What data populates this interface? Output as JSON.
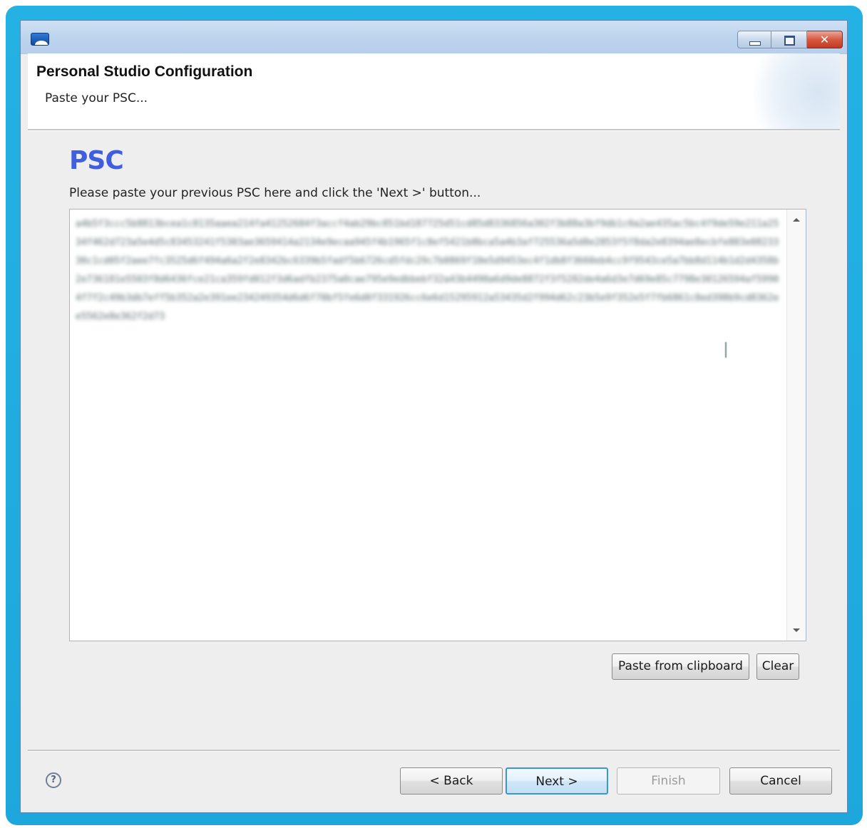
{
  "window": {
    "icon": "app-window-icon",
    "controls": {
      "minimize": "minimize-icon",
      "maximize": "maximize-icon",
      "close_glyph": "✕"
    }
  },
  "header": {
    "title": "Personal Studio Configuration",
    "subtitle": "Paste your PSC..."
  },
  "main": {
    "section_title": "PSC",
    "instruction": "Please paste your previous PSC here and click the 'Next >' button...",
    "psc_text": "a4b5f3ccc5b8813bcea1c8135aaea214fa41252684f3accf4ab29bc851bd187725d51cd85d8336856a302f3b88a3bf9db1c0a2ae435ac5bc4f9de59e211a2534f462d723a5e4d5c83453241f5303ae3659414a2134e9ecaa945f4b1965f1c8ef5421b8bca5a4b3af725536a5d8e2853f5f8da2e8394ae8ecbfe883e0823330c1cd05f2aee7fc3525d6f494a6a2f2e8342bc6339b5fadf5b6726cd5fdc29c7b0869f10e5d9453ec4f1db8f3660eb4cc9f9543ce5a7bb8d114b1d2d4358b2e736181e5503f8d6436fce21ca359fd012f3d6adfb2375a0cae795e9edbbebf32a43b4490a6d9de8872f3f5282de4a6d3e7d69e85c7798e30126594af59904f7f2c49b3db7eff5b352a2e391ee234249354d6d6f70bf5fe6d0f331926cc6e6d15295912a53435d2f994d62c23b5e9f352e5f7fb6861c8ed398b9cd8362ee5562e8e362f2d73"
  },
  "actions": {
    "paste_from_clipboard": "Paste from clipboard",
    "clear": "Clear"
  },
  "footer": {
    "help_icon": "help-icon",
    "help_glyph": "?",
    "back": "< Back",
    "next": "Next >",
    "finish": "Finish",
    "cancel": "Cancel"
  },
  "colors": {
    "accent_title": "#3f5ee0",
    "desktop_frame": "#1ea7dc",
    "default_button_border": "#3c95d6"
  }
}
